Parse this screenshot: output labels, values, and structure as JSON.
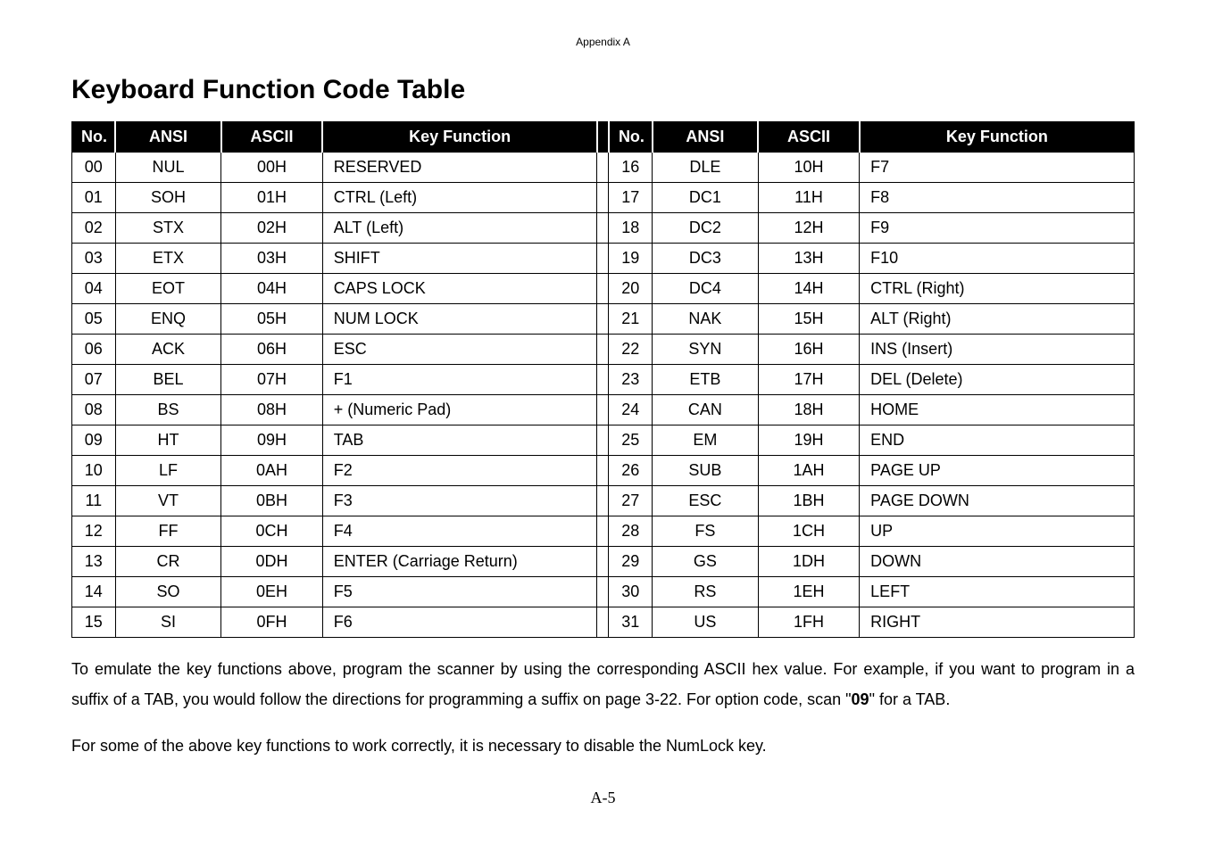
{
  "appendix": "Appendix A",
  "title": "Keyboard Function Code Table",
  "headers": {
    "no": "No.",
    "ansi": "ANSI",
    "ascii": "ASCII",
    "func": "Key Function"
  },
  "left": [
    {
      "no": "00",
      "ansi": "NUL",
      "ascii": "00H",
      "func": "RESERVED"
    },
    {
      "no": "01",
      "ansi": "SOH",
      "ascii": "01H",
      "func": "CTRL (Left)"
    },
    {
      "no": "02",
      "ansi": "STX",
      "ascii": "02H",
      "func": "ALT (Left)"
    },
    {
      "no": "03",
      "ansi": "ETX",
      "ascii": "03H",
      "func": "SHIFT"
    },
    {
      "no": "04",
      "ansi": "EOT",
      "ascii": "04H",
      "func": "CAPS LOCK"
    },
    {
      "no": "05",
      "ansi": "ENQ",
      "ascii": "05H",
      "func": "NUM LOCK"
    },
    {
      "no": "06",
      "ansi": "ACK",
      "ascii": "06H",
      "func": "ESC"
    },
    {
      "no": "07",
      "ansi": "BEL",
      "ascii": "07H",
      "func": "F1"
    },
    {
      "no": "08",
      "ansi": "BS",
      "ascii": "08H",
      "func": "+ (Numeric Pad)"
    },
    {
      "no": "09",
      "ansi": "HT",
      "ascii": "09H",
      "func": "TAB"
    },
    {
      "no": "10",
      "ansi": "LF",
      "ascii": "0AH",
      "func": "F2"
    },
    {
      "no": "11",
      "ansi": "VT",
      "ascii": "0BH",
      "func": "F3"
    },
    {
      "no": "12",
      "ansi": "FF",
      "ascii": "0CH",
      "func": "F4"
    },
    {
      "no": "13",
      "ansi": "CR",
      "ascii": "0DH",
      "func": "ENTER (Carriage Return)"
    },
    {
      "no": "14",
      "ansi": "SO",
      "ascii": "0EH",
      "func": "F5"
    },
    {
      "no": "15",
      "ansi": "SI",
      "ascii": "0FH",
      "func": "F6"
    }
  ],
  "right": [
    {
      "no": "16",
      "ansi": "DLE",
      "ascii": "10H",
      "func": "F7"
    },
    {
      "no": "17",
      "ansi": "DC1",
      "ascii": "11H",
      "func": "F8"
    },
    {
      "no": "18",
      "ansi": "DC2",
      "ascii": "12H",
      "func": "F9"
    },
    {
      "no": "19",
      "ansi": "DC3",
      "ascii": "13H",
      "func": "F10"
    },
    {
      "no": "20",
      "ansi": "DC4",
      "ascii": "14H",
      "func": "CTRL (Right)"
    },
    {
      "no": "21",
      "ansi": "NAK",
      "ascii": "15H",
      "func": "ALT (Right)"
    },
    {
      "no": "22",
      "ansi": "SYN",
      "ascii": "16H",
      "func": "INS (Insert)"
    },
    {
      "no": "23",
      "ansi": "ETB",
      "ascii": "17H",
      "func": "DEL (Delete)"
    },
    {
      "no": "24",
      "ansi": "CAN",
      "ascii": "18H",
      "func": "HOME"
    },
    {
      "no": "25",
      "ansi": "EM",
      "ascii": "19H",
      "func": "END"
    },
    {
      "no": "26",
      "ansi": "SUB",
      "ascii": "1AH",
      "func": "PAGE UP"
    },
    {
      "no": "27",
      "ansi": "ESC",
      "ascii": "1BH",
      "func": "PAGE DOWN"
    },
    {
      "no": "28",
      "ansi": "FS",
      "ascii": "1CH",
      "func": "UP"
    },
    {
      "no": "29",
      "ansi": "GS",
      "ascii": "1DH",
      "func": "DOWN"
    },
    {
      "no": "30",
      "ansi": "RS",
      "ascii": "1EH",
      "func": "LEFT"
    },
    {
      "no": "31",
      "ansi": "US",
      "ascii": "1FH",
      "func": "RIGHT"
    }
  ],
  "notes": {
    "p1a": "To emulate the key functions above, program the scanner by using the corresponding ASCII hex value. For example, if you want to program in a suffix of a TAB, you would follow the directions for programming a suffix on page 3-22. For option code, scan \"",
    "p1code": "09",
    "p1b": "\" for a TAB.",
    "p2": "For some of the above key functions to work correctly, it is necessary to disable the NumLock key."
  },
  "pagenum": "A-5"
}
